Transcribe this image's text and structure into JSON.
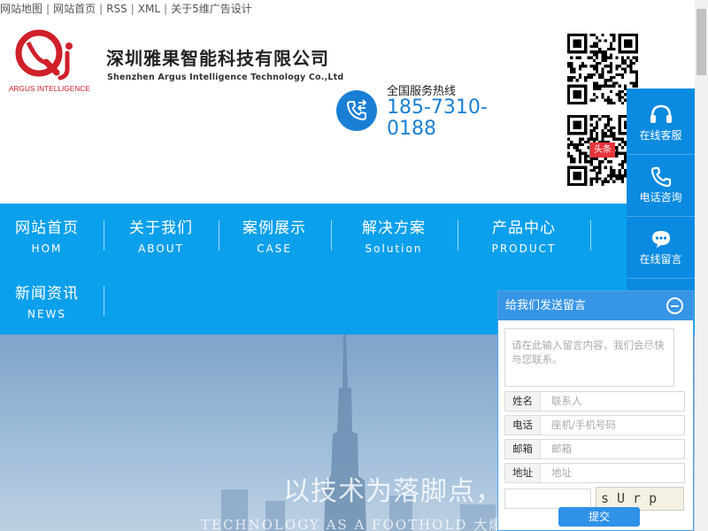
{
  "toplinks": [
    "网站地图",
    "网站首页",
    "RSS",
    "XML",
    "关于5维广告设计"
  ],
  "header": {
    "company_name": "深圳雅果智能科技有限公司",
    "company_en": "Shenzhen Argus Intelligence Technology Co.,Ltd",
    "logo_text": "ARGUS INTELLIGENCE",
    "hotline_label": "全国服务热线",
    "hotline_number": "185-7310-0188",
    "qr2_badge": "头条"
  },
  "nav": [
    {
      "cn": "网站首页",
      "en": "HOM"
    },
    {
      "cn": "关于我们",
      "en": "ABOUT"
    },
    {
      "cn": "案例展示",
      "en": "CASE"
    },
    {
      "cn": "解决方案",
      "en": "Solution"
    },
    {
      "cn": "产品中心",
      "en": "PRODUCT"
    },
    {
      "cn": "新闻资讯",
      "en": "NEWS"
    }
  ],
  "service": {
    "items": [
      "在线客服",
      "电话咨询",
      "在线留言"
    ]
  },
  "banner": {
    "tagline": "以技术为落脚点，",
    "subline": "TECHNOLOGY AS A FOOTHOLD  大爆行实验"
  },
  "message": {
    "title": "给我们发送留言",
    "content_placeholder": "请在此输入留言内容，我们会尽快与您联系。",
    "fields": [
      {
        "label": "姓名",
        "placeholder": "联系人"
      },
      {
        "label": "电话",
        "placeholder": "座机/手机号码"
      },
      {
        "label": "邮箱",
        "placeholder": "邮箱"
      },
      {
        "label": "地址",
        "placeholder": "地址"
      }
    ],
    "captcha": "sUrp",
    "submit": "提交"
  },
  "colors": {
    "primary": "#0aa0ec",
    "service_bar": "#0a8ae0",
    "hotline": "#1a7fd4",
    "logo_red": "#d0202a"
  }
}
